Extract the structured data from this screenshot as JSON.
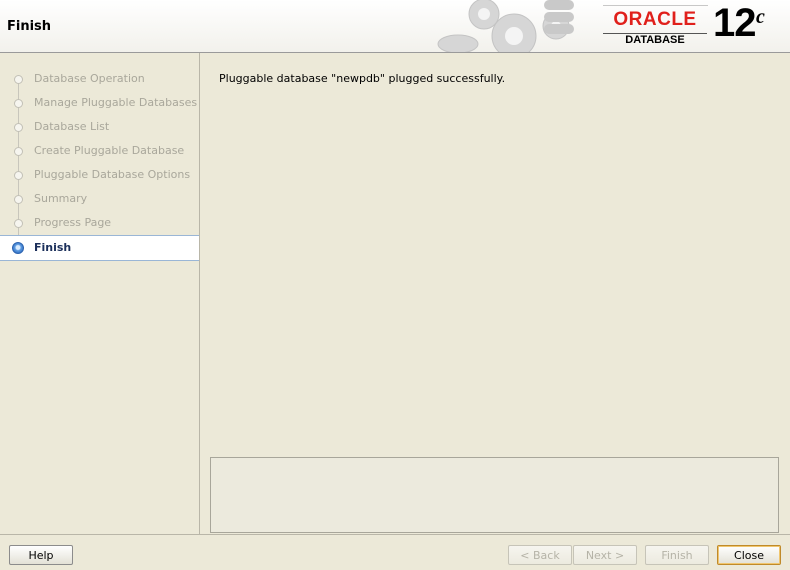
{
  "header": {
    "title": "Finish",
    "brand": {
      "oracle": "ORACLE",
      "registered": "®",
      "product": "DATABASE",
      "version": "12",
      "version_suffix": "c"
    }
  },
  "steps": [
    {
      "label": "Database Operation",
      "state": "done"
    },
    {
      "label": "Manage Pluggable Databases",
      "state": "done"
    },
    {
      "label": "Database List",
      "state": "done"
    },
    {
      "label": "Create Pluggable Database",
      "state": "done"
    },
    {
      "label": "Pluggable Database Options",
      "state": "done"
    },
    {
      "label": "Summary",
      "state": "done"
    },
    {
      "label": "Progress Page",
      "state": "done"
    },
    {
      "label": "Finish",
      "state": "current"
    }
  ],
  "main": {
    "message": "Pluggable database \"newpdb\" plugged successfully.",
    "details": ""
  },
  "footer": {
    "help": "Help",
    "back": "< Back",
    "next": "Next >",
    "finish": "Finish",
    "close": "Close"
  },
  "colors": {
    "background": "#ece9d8",
    "oracle_red": "#e0201b",
    "active_step_text": "#1b2f5a",
    "disabled_text": "#b5b3a7"
  }
}
